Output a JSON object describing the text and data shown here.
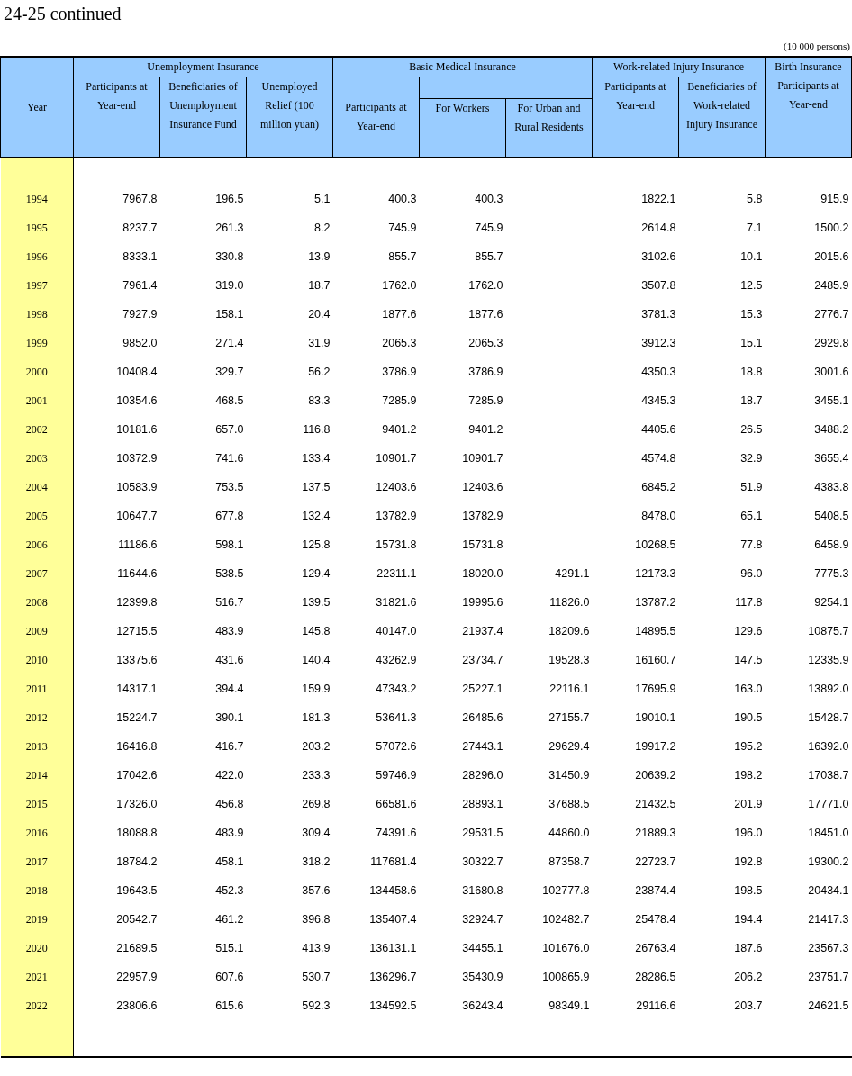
{
  "title": "24-25 continued",
  "unit": "(10 000 persons)",
  "header": {
    "year": "Year",
    "unemployment": {
      "label": "Unemployment Insurance",
      "columns": [
        "Participants at Year-end",
        "Beneficiaries of Unemployment Insurance Fund",
        "Unemployed Relief (100 million yuan)"
      ]
    },
    "medical": {
      "label": "Basic Medical Insurance",
      "participants": "Participants at Year-end",
      "sub_columns": [
        "For Workers",
        "For Urban and Rural Residents"
      ]
    },
    "injury": {
      "label": "Work-related Injury Insurance",
      "columns": [
        "Participants at Year-end",
        "Beneficiaries of Work-related Injury Insurance"
      ]
    },
    "birth": "Birth Insurance Participants at Year-end"
  },
  "rows": [
    [
      "1994",
      "7967.8",
      "196.5",
      "5.1",
      "400.3",
      "400.3",
      null,
      "1822.1",
      "5.8",
      "915.9"
    ],
    [
      "1995",
      "8237.7",
      "261.3",
      "8.2",
      "745.9",
      "745.9",
      null,
      "2614.8",
      "7.1",
      "1500.2"
    ],
    [
      "1996",
      "8333.1",
      "330.8",
      "13.9",
      "855.7",
      "855.7",
      null,
      "3102.6",
      "10.1",
      "2015.6"
    ],
    [
      "1997",
      "7961.4",
      "319.0",
      "18.7",
      "1762.0",
      "1762.0",
      null,
      "3507.8",
      "12.5",
      "2485.9"
    ],
    [
      "1998",
      "7927.9",
      "158.1",
      "20.4",
      "1877.6",
      "1877.6",
      null,
      "3781.3",
      "15.3",
      "2776.7"
    ],
    [
      "1999",
      "9852.0",
      "271.4",
      "31.9",
      "2065.3",
      "2065.3",
      null,
      "3912.3",
      "15.1",
      "2929.8"
    ],
    [
      "2000",
      "10408.4",
      "329.7",
      "56.2",
      "3786.9",
      "3786.9",
      null,
      "4350.3",
      "18.8",
      "3001.6"
    ],
    [
      "2001",
      "10354.6",
      "468.5",
      "83.3",
      "7285.9",
      "7285.9",
      null,
      "4345.3",
      "18.7",
      "3455.1"
    ],
    [
      "2002",
      "10181.6",
      "657.0",
      "116.8",
      "9401.2",
      "9401.2",
      null,
      "4405.6",
      "26.5",
      "3488.2"
    ],
    [
      "2003",
      "10372.9",
      "741.6",
      "133.4",
      "10901.7",
      "10901.7",
      null,
      "4574.8",
      "32.9",
      "3655.4"
    ],
    [
      "2004",
      "10583.9",
      "753.5",
      "137.5",
      "12403.6",
      "12403.6",
      null,
      "6845.2",
      "51.9",
      "4383.8"
    ],
    [
      "2005",
      "10647.7",
      "677.8",
      "132.4",
      "13782.9",
      "13782.9",
      null,
      "8478.0",
      "65.1",
      "5408.5"
    ],
    [
      "2006",
      "11186.6",
      "598.1",
      "125.8",
      "15731.8",
      "15731.8",
      null,
      "10268.5",
      "77.8",
      "6458.9"
    ],
    [
      "2007",
      "11644.6",
      "538.5",
      "129.4",
      "22311.1",
      "18020.0",
      "4291.1",
      "12173.3",
      "96.0",
      "7775.3"
    ],
    [
      "2008",
      "12399.8",
      "516.7",
      "139.5",
      "31821.6",
      "19995.6",
      "11826.0",
      "13787.2",
      "117.8",
      "9254.1"
    ],
    [
      "2009",
      "12715.5",
      "483.9",
      "145.8",
      "40147.0",
      "21937.4",
      "18209.6",
      "14895.5",
      "129.6",
      "10875.7"
    ],
    [
      "2010",
      "13375.6",
      "431.6",
      "140.4",
      "43262.9",
      "23734.7",
      "19528.3",
      "16160.7",
      "147.5",
      "12335.9"
    ],
    [
      "2011",
      "14317.1",
      "394.4",
      "159.9",
      "47343.2",
      "25227.1",
      "22116.1",
      "17695.9",
      "163.0",
      "13892.0"
    ],
    [
      "2012",
      "15224.7",
      "390.1",
      "181.3",
      "53641.3",
      "26485.6",
      "27155.7",
      "19010.1",
      "190.5",
      "15428.7"
    ],
    [
      "2013",
      "16416.8",
      "416.7",
      "203.2",
      "57072.6",
      "27443.1",
      "29629.4",
      "19917.2",
      "195.2",
      "16392.0"
    ],
    [
      "2014",
      "17042.6",
      "422.0",
      "233.3",
      "59746.9",
      "28296.0",
      "31450.9",
      "20639.2",
      "198.2",
      "17038.7"
    ],
    [
      "2015",
      "17326.0",
      "456.8",
      "269.8",
      "66581.6",
      "28893.1",
      "37688.5",
      "21432.5",
      "201.9",
      "17771.0"
    ],
    [
      "2016",
      "18088.8",
      "483.9",
      "309.4",
      "74391.6",
      "29531.5",
      "44860.0",
      "21889.3",
      "196.0",
      "18451.0"
    ],
    [
      "2017",
      "18784.2",
      "458.1",
      "318.2",
      "117681.4",
      "30322.7",
      "87358.7",
      "22723.7",
      "192.8",
      "19300.2"
    ],
    [
      "2018",
      "19643.5",
      "452.3",
      "357.6",
      "134458.6",
      "31680.8",
      "102777.8",
      "23874.4",
      "198.5",
      "20434.1"
    ],
    [
      "2019",
      "20542.7",
      "461.2",
      "396.8",
      "135407.4",
      "32924.7",
      "102482.7",
      "25478.4",
      "194.4",
      "21417.3"
    ],
    [
      "2020",
      "21689.5",
      "515.1",
      "413.9",
      "136131.1",
      "34455.1",
      "101676.0",
      "26763.4",
      "187.6",
      "23567.3"
    ],
    [
      "2021",
      "22957.9",
      "607.6",
      "530.7",
      "136296.7",
      "35430.9",
      "100865.9",
      "28286.5",
      "206.2",
      "23751.7"
    ],
    [
      "2022",
      "23806.6",
      "615.6",
      "592.3",
      "134592.5",
      "36243.4",
      "98349.1",
      "29116.6",
      "203.7",
      "24621.5"
    ]
  ]
}
